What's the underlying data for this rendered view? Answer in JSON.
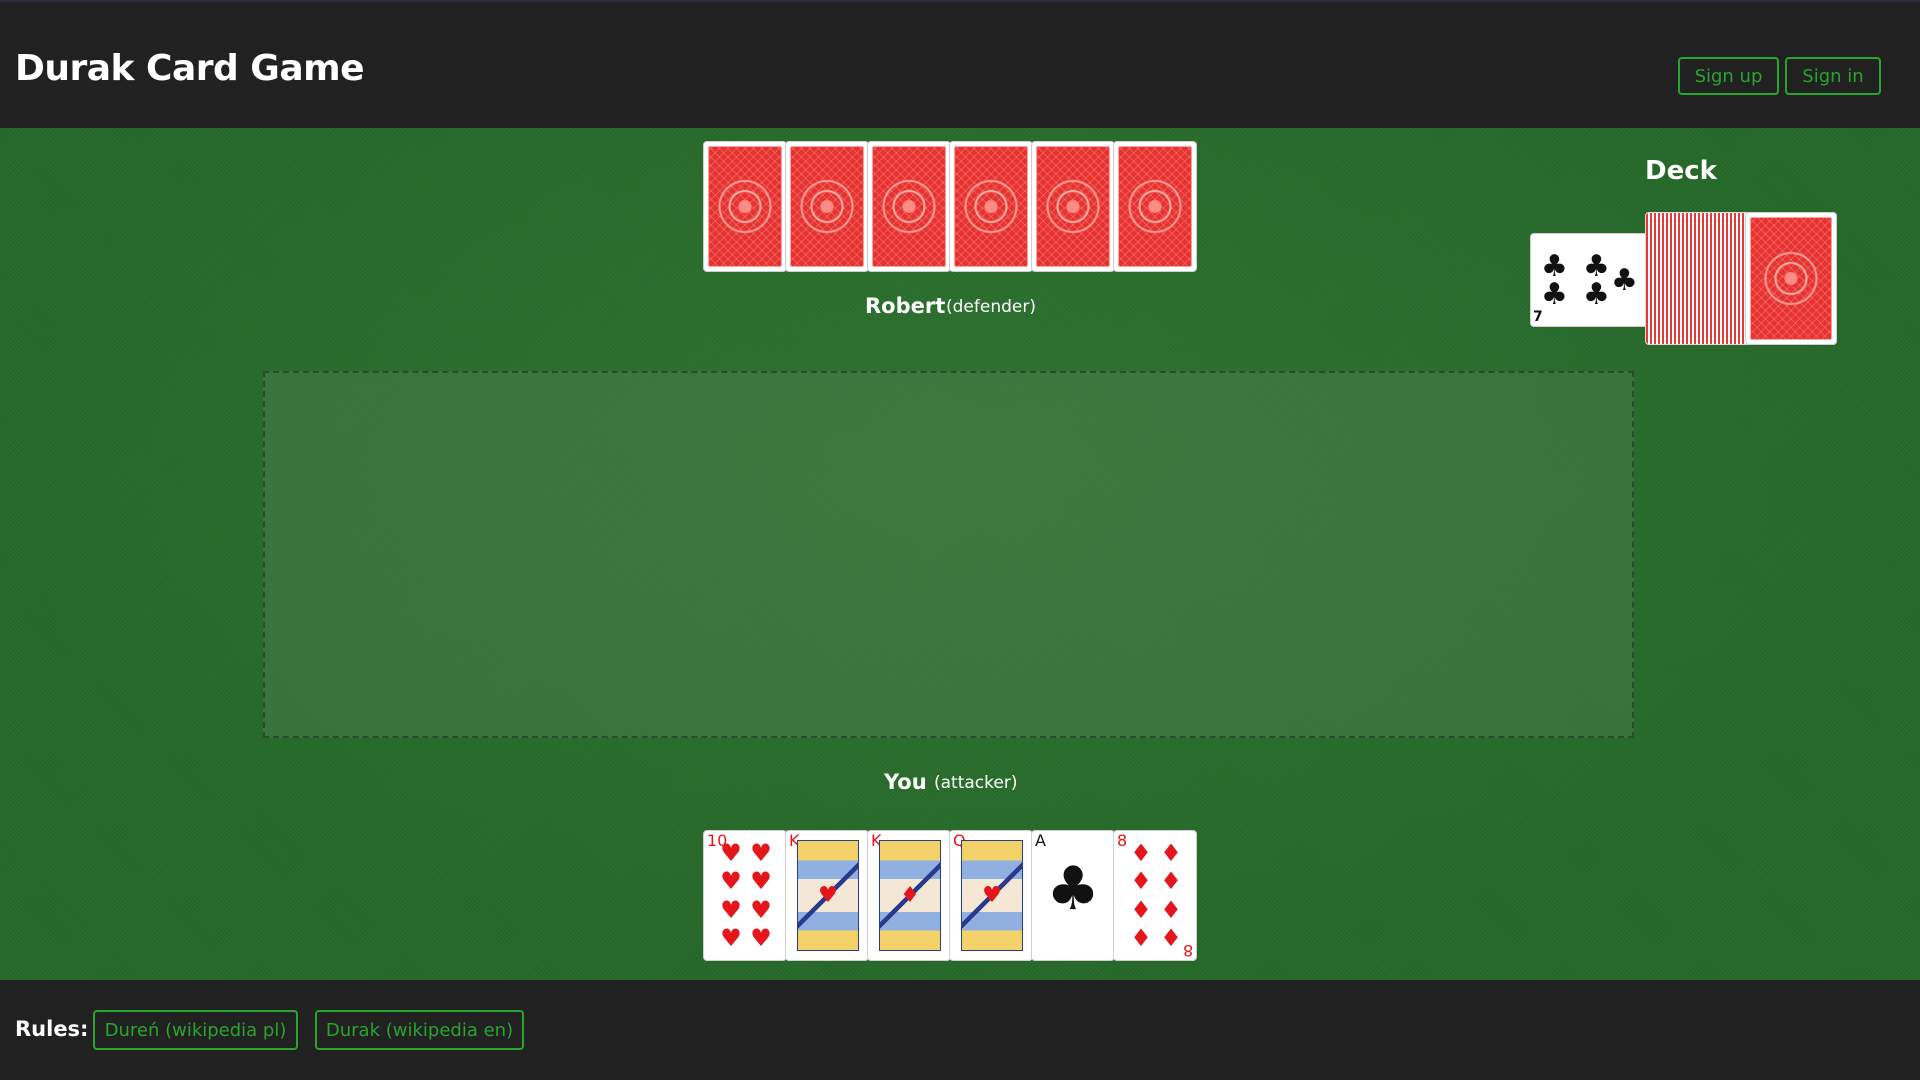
{
  "header": {
    "title": "Durak Card Game",
    "sign_up": "Sign up",
    "sign_in": "Sign in"
  },
  "opponent": {
    "name": "Robert",
    "role": "(defender)",
    "card_count": 6
  },
  "player": {
    "name": "You",
    "role": "(attacker)",
    "hand": [
      {
        "rank": "10",
        "suit": "♥",
        "color": "red"
      },
      {
        "rank": "K",
        "suit": "♥",
        "color": "red"
      },
      {
        "rank": "K",
        "suit": "♦",
        "color": "red"
      },
      {
        "rank": "Q",
        "suit": "♥",
        "color": "red"
      },
      {
        "rank": "A",
        "suit": "♣",
        "color": "black"
      },
      {
        "rank": "8",
        "suit": "♦",
        "color": "red"
      }
    ]
  },
  "deck": {
    "title": "Deck",
    "trump": {
      "rank": "7",
      "suit": "♣",
      "color": "black"
    }
  },
  "footer": {
    "rules_label": "Rules:",
    "link_pl": "Dureń (wikipedia pl)",
    "link_en": "Durak (wikipedia en)"
  },
  "colors": {
    "accent_green": "#27a52d",
    "felt_green": "#26692a",
    "card_red": "#e4161b",
    "header_bg": "#212121"
  }
}
